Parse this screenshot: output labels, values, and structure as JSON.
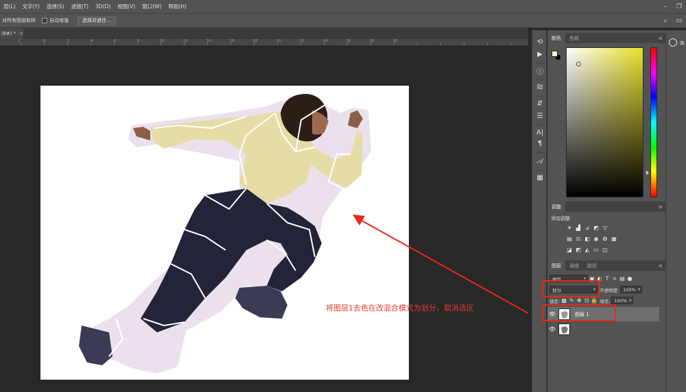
{
  "menu": [
    "层(L)",
    "文字(Y)",
    "选择(S)",
    "滤镜(T)",
    "3D(D)",
    "视图(V)",
    "窗口(W)",
    "帮助(H)"
  ],
  "options": {
    "sample_all_label": "对所有图层取样",
    "auto_enhance_label": "自动增强",
    "select_subject_button": "选择并遮住..."
  },
  "doc_tab": {
    "label": "/8#) *",
    "close": "×"
  },
  "ruler_labels": [
    "2",
    "0",
    "2",
    "4",
    "6",
    "8",
    "10",
    "12",
    "14",
    "16",
    "18",
    "20",
    "22",
    "24",
    "26",
    "28",
    "30"
  ],
  "annotation": "将图层1去色在改混合模式为划分，取消选区",
  "panels": {
    "color_tabs": [
      "颜色",
      "色板"
    ],
    "adjustments_tab": "调整",
    "adjustments_add_label": "添加调整",
    "layers_tabs": [
      "图层",
      "通道",
      "路径"
    ],
    "filter_kind": "类型",
    "blend_mode": "划分",
    "opacity_label": "不透明度:",
    "opacity_value": "100%",
    "lock_label": "锁定:",
    "fill_label": "填充:",
    "fill_value": "100%",
    "layer1_name": "图层 1"
  },
  "far_panel": {
    "label": "库"
  },
  "colors": {
    "foreground": "#fdf6cf",
    "background": "#000000",
    "annotation_red": "#e23a2e"
  },
  "icons": [
    "search-icon",
    "workspace-icon",
    "history-icon",
    "play-icon",
    "info-icon",
    "character-icon",
    "brush-icon",
    "properties-icon",
    "paragraph-icon",
    "glyphs-icon",
    "eye-icon",
    "library-icon"
  ]
}
